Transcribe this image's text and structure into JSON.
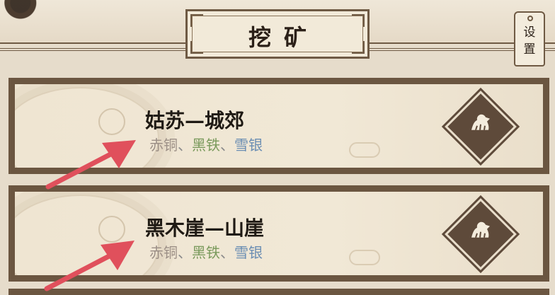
{
  "header": {
    "title": "挖矿",
    "settings_label": "设置"
  },
  "locations": [
    {
      "name": "姑苏—城郊",
      "ores": [
        {
          "label": "赤铜",
          "color": "#9c8f86"
        },
        {
          "label": "、",
          "color": "#8c8c8c"
        },
        {
          "label": "黑铁",
          "color": "#7a9a5c"
        },
        {
          "label": "、",
          "color": "#8c8c8c"
        },
        {
          "label": "雪银",
          "color": "#6b8eb3"
        }
      ]
    },
    {
      "name": "黑木崖—山崖",
      "ores": [
        {
          "label": "赤铜",
          "color": "#9c8f86"
        },
        {
          "label": "、",
          "color": "#8c8c8c"
        },
        {
          "label": "黑铁",
          "color": "#7a9a5c"
        },
        {
          "label": "、",
          "color": "#8c8c8c"
        },
        {
          "label": "雪银",
          "color": "#6b8eb3"
        }
      ]
    }
  ],
  "icons": {
    "go": "ore-travel-icon",
    "annotation": "red-arrow-annotation"
  },
  "colors": {
    "frame": "#6b5641",
    "button": "#5e4a3a",
    "annotation": "#e0505c"
  }
}
